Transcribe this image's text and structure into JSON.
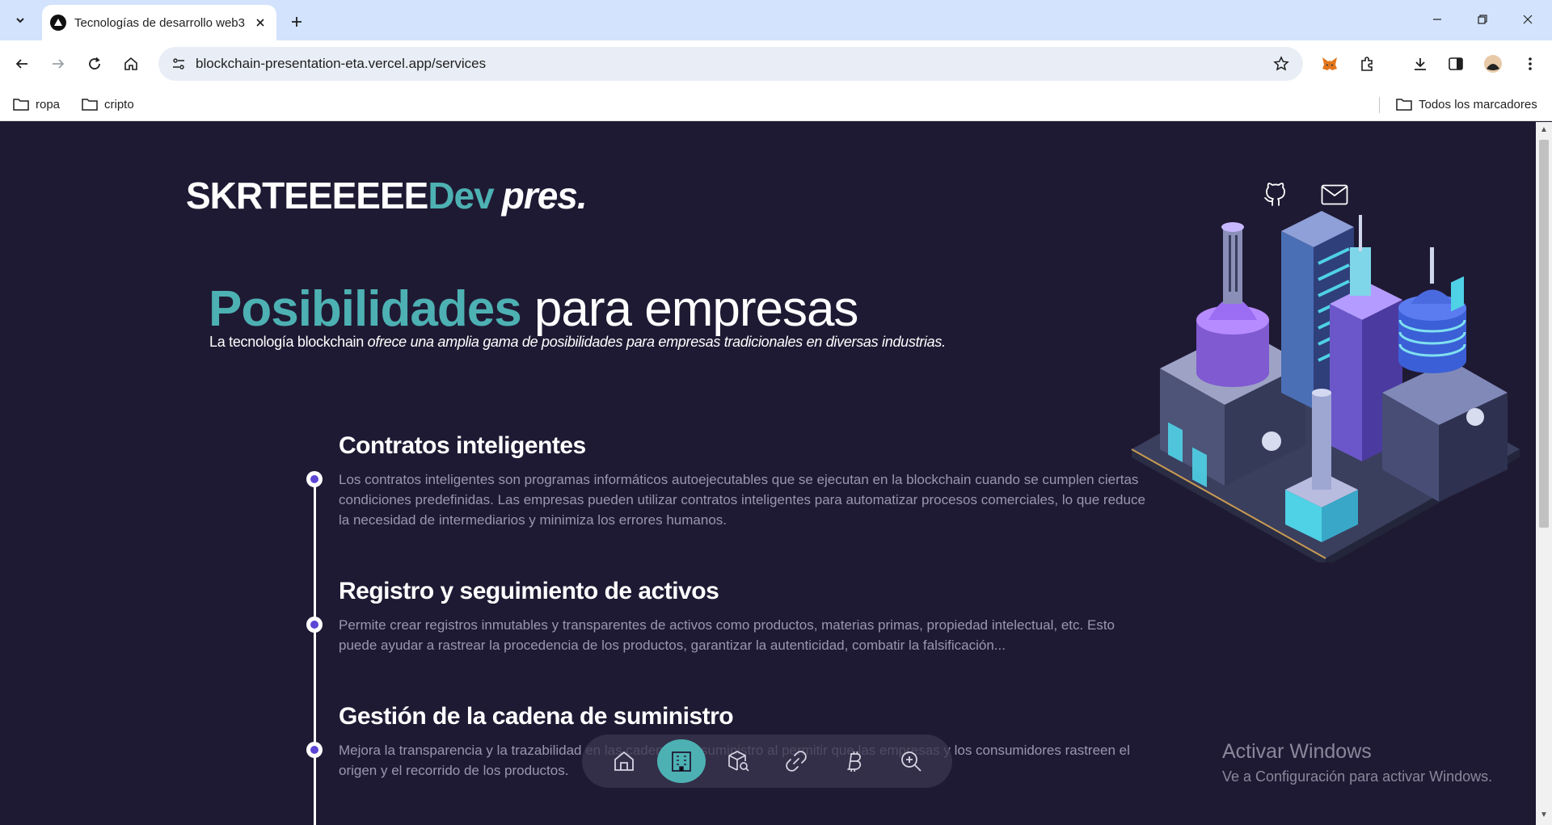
{
  "browser": {
    "tab_title": "Tecnologías de desarrollo web3",
    "url": "blockchain-presentation-eta.vercel.app/services",
    "bookmarks": [
      "ropa",
      "cripto"
    ],
    "all_bookmarks_label": "Todos los marcadores"
  },
  "site": {
    "logo_main": "SKRTEEEEEE",
    "logo_dev": "Dev",
    "logo_pres": "pres."
  },
  "hero": {
    "title_accent": "Posibilidades",
    "title_rest": " para empresas",
    "subtitle_plain": "La tecnología blockchain ",
    "subtitle_italic": "ofrece una amplia gama de posibilidades para empresas tradicionales en diversas industrias."
  },
  "items": [
    {
      "title": "Contratos inteligentes",
      "description": "Los contratos inteligentes son programas informáticos autoejecutables que se ejecutan en la blockchain cuando se cumplen ciertas condiciones predefinidas. Las empresas pueden utilizar contratos inteligentes para automatizar procesos comerciales, lo que reduce la necesidad de intermediarios y minimiza los errores humanos."
    },
    {
      "title": "Registro y seguimiento de activos",
      "description": "Permite crear registros inmutables y transparentes de activos como productos, materias primas, propiedad intelectual, etc. Esto puede ayudar a rastrear la procedencia de los productos, garantizar la autenticidad, combatir la falsificación..."
    },
    {
      "title": "Gestión de la cadena de suministro",
      "description": "Mejora la transparencia y la trazabilidad en las cadenas de suministro al permitir que las empresas y los consumidores rastreen el origen y el recorrido de los productos."
    }
  ],
  "dock": {
    "icons": [
      "home-icon",
      "building-icon",
      "cube-search-icon",
      "link-icon",
      "bitcoin-icon",
      "zoom-in-icon"
    ],
    "active_index": 1
  },
  "watermark": {
    "title": "Activar Windows",
    "subtitle": "Ve a Configuración para activar Windows."
  },
  "colors": {
    "background": "#1f1a33",
    "accent": "#4db1b3",
    "timeline_dot": "#5b46d6",
    "description": "#9a96b2"
  }
}
